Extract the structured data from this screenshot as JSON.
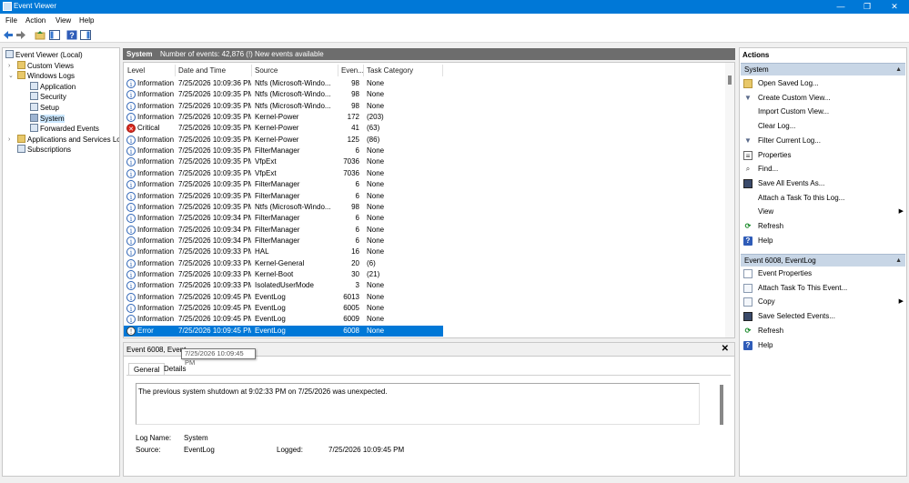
{
  "window": {
    "title": "Event Viewer",
    "controls": {
      "minimize": "—",
      "maximize": "❐",
      "close": "✕"
    }
  },
  "menu": [
    "File",
    "Action",
    "View",
    "Help"
  ],
  "tree": {
    "root": "Event Viewer (Local)",
    "custom_views": "Custom Views",
    "windows_logs": "Windows Logs",
    "logs": [
      "Application",
      "Security",
      "Setup",
      "System",
      "Forwarded Events"
    ],
    "apps_services": "Applications and Services Log",
    "subscriptions": "Subscriptions"
  },
  "center": {
    "log_name": "System",
    "event_count": "Number of events: 42,876 (!) New events available"
  },
  "columns": [
    "Level",
    "Date and Time",
    "Source",
    "Even...",
    "Task Category"
  ],
  "events": [
    {
      "level": "Information",
      "icon": "info",
      "date": "7/25/2026 10:09:36 PM",
      "source": "Ntfs (Microsoft-Windo...",
      "id": "98",
      "task": "None"
    },
    {
      "level": "Information",
      "icon": "info",
      "date": "7/25/2026 10:09:35 PM",
      "source": "Ntfs (Microsoft-Windo...",
      "id": "98",
      "task": "None"
    },
    {
      "level": "Information",
      "icon": "info",
      "date": "7/25/2026 10:09:35 PM",
      "source": "Ntfs (Microsoft-Windo...",
      "id": "98",
      "task": "None"
    },
    {
      "level": "Information",
      "icon": "info",
      "date": "7/25/2026 10:09:35 PM",
      "source": "Kernel-Power",
      "id": "172",
      "task": "(203)"
    },
    {
      "level": "Critical",
      "icon": "critical",
      "date": "7/25/2026 10:09:35 PM",
      "source": "Kernel-Power",
      "id": "41",
      "task": "(63)"
    },
    {
      "level": "Information",
      "icon": "info",
      "date": "7/25/2026 10:09:35 PM",
      "source": "Kernel-Power",
      "id": "125",
      "task": "(86)"
    },
    {
      "level": "Information",
      "icon": "info",
      "date": "7/25/2026 10:09:35 PM",
      "source": "FilterManager",
      "id": "6",
      "task": "None"
    },
    {
      "level": "Information",
      "icon": "info",
      "date": "7/25/2026 10:09:35 PM",
      "source": "VfpExt",
      "id": "7036",
      "task": "None"
    },
    {
      "level": "Information",
      "icon": "info",
      "date": "7/25/2026 10:09:35 PM",
      "source": "VfpExt",
      "id": "7036",
      "task": "None"
    },
    {
      "level": "Information",
      "icon": "info",
      "date": "7/25/2026 10:09:35 PM",
      "source": "FilterManager",
      "id": "6",
      "task": "None"
    },
    {
      "level": "Information",
      "icon": "info",
      "date": "7/25/2026 10:09:35 PM",
      "source": "FilterManager",
      "id": "6",
      "task": "None"
    },
    {
      "level": "Information",
      "icon": "info",
      "date": "7/25/2026 10:09:35 PM",
      "source": "Ntfs (Microsoft-Windo...",
      "id": "98",
      "task": "None"
    },
    {
      "level": "Information",
      "icon": "info",
      "date": "7/25/2026 10:09:34 PM",
      "source": "FilterManager",
      "id": "6",
      "task": "None"
    },
    {
      "level": "Information",
      "icon": "info",
      "date": "7/25/2026 10:09:34 PM",
      "source": "FilterManager",
      "id": "6",
      "task": "None"
    },
    {
      "level": "Information",
      "icon": "info",
      "date": "7/25/2026 10:09:34 PM",
      "source": "FilterManager",
      "id": "6",
      "task": "None"
    },
    {
      "level": "Information",
      "icon": "info",
      "date": "7/25/2026 10:09:33 PM",
      "source": "HAL",
      "id": "16",
      "task": "None"
    },
    {
      "level": "Information",
      "icon": "info",
      "date": "7/25/2026 10:09:33 PM",
      "source": "Kernel-General",
      "id": "20",
      "task": "(6)"
    },
    {
      "level": "Information",
      "icon": "info",
      "date": "7/25/2026 10:09:33 PM",
      "source": "Kernel-Boot",
      "id": "30",
      "task": "(21)"
    },
    {
      "level": "Information",
      "icon": "info",
      "date": "7/25/2026 10:09:33 PM",
      "source": "IsolatedUserMode",
      "id": "3",
      "task": "None"
    },
    {
      "level": "Information",
      "icon": "info",
      "date": "7/25/2026 10:09:45 PM",
      "source": "EventLog",
      "id": "6013",
      "task": "None"
    },
    {
      "level": "Information",
      "icon": "info",
      "date": "7/25/2026 10:09:45 PM",
      "source": "EventLog",
      "id": "6005",
      "task": "None"
    },
    {
      "level": "Information",
      "icon": "info",
      "date": "7/25/2026 10:09:45 PM",
      "source": "EventLog",
      "id": "6009",
      "task": "None"
    },
    {
      "level": "Error",
      "icon": "error",
      "date": "7/25/2026 10:09:45 PM",
      "source": "EventLog",
      "id": "6008",
      "task": "None",
      "selected": true
    }
  ],
  "details": {
    "title": "Event 6008, EventLog",
    "title_visible": "Event 6008, Event",
    "tooltip": "7/25/2026 10:09:45 PM",
    "tabs": [
      "General",
      "Details"
    ],
    "message": "The previous system shutdown at 9:02:33 PM on 7/25/2026 was unexpected.",
    "log_name_label": "Log Name:",
    "log_name": "System",
    "source_label": "Source:",
    "source": "EventLog",
    "logged_label": "Logged:",
    "logged": "7/25/2026 10:09:45 PM"
  },
  "actions": {
    "title": "Actions",
    "section1": "System",
    "items1": [
      {
        "label": "Open Saved Log...",
        "icon": "folder"
      },
      {
        "label": "Create Custom View...",
        "icon": "filter"
      },
      {
        "label": "Import Custom View...",
        "icon": "none"
      },
      {
        "label": "Clear Log...",
        "icon": "none"
      },
      {
        "label": "Filter Current Log...",
        "icon": "filter"
      },
      {
        "label": "Properties",
        "icon": "props"
      },
      {
        "label": "Find...",
        "icon": "find"
      },
      {
        "label": "Save All Events As...",
        "icon": "save"
      },
      {
        "label": "Attach a Task To this Log...",
        "icon": "none"
      },
      {
        "label": "View",
        "icon": "none",
        "submenu": true
      },
      {
        "label": "Refresh",
        "icon": "refresh"
      },
      {
        "label": "Help",
        "icon": "help"
      }
    ],
    "section2": "Event 6008, EventLog",
    "items2": [
      {
        "label": "Event Properties",
        "icon": "evprops"
      },
      {
        "label": "Attach Task To This Event...",
        "icon": "task"
      },
      {
        "label": "Copy",
        "icon": "copy",
        "submenu": true
      },
      {
        "label": "Save Selected Events...",
        "icon": "save"
      },
      {
        "label": "Refresh",
        "icon": "refresh"
      },
      {
        "label": "Help",
        "icon": "help"
      }
    ]
  },
  "colors": {
    "titlebar": "#0078d7",
    "selection": "#0078d7",
    "section_header": "#c8d6e6",
    "center_header": "#6d6d6d",
    "critical": "#d9281e"
  }
}
